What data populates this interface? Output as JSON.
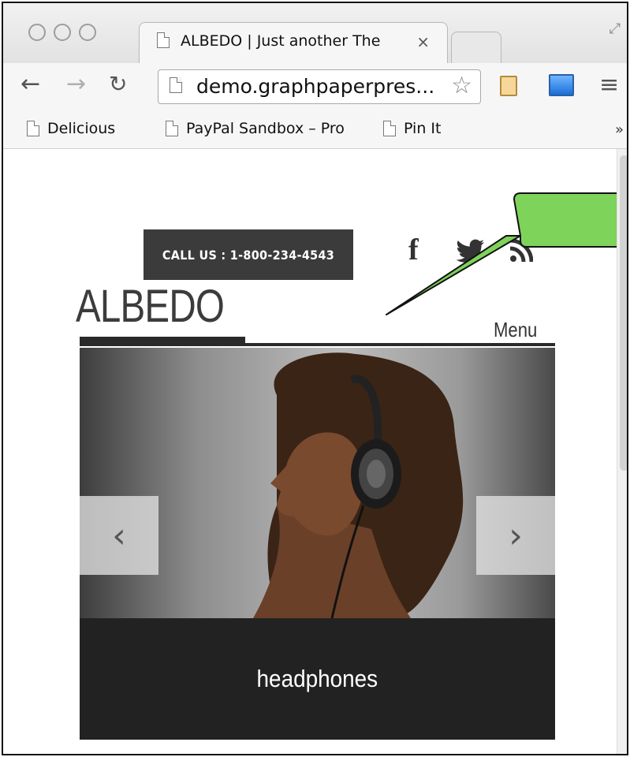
{
  "browser": {
    "tab": {
      "title": "ALBEDO | Just another The",
      "close": "×"
    },
    "address": {
      "url": "demo.graphpaperpres..."
    },
    "bookmarks": [
      {
        "label": "Delicious"
      },
      {
        "label": "PayPal Sandbox – Pro"
      },
      {
        "label": "Pin It"
      }
    ],
    "bookmarks_more": "»"
  },
  "site": {
    "call_us": "CALL US : 1-800-234-4543",
    "social": {
      "facebook": "f",
      "twitter": "❧",
      "rss": "◥"
    },
    "logo": "ALBEDO",
    "menu": "Menu",
    "slider": {
      "prev": "‹",
      "next": "›",
      "caption": "headphones"
    }
  },
  "colors": {
    "callout_fill": "#7ed35a",
    "dark_bar": "#222222",
    "call_us_bg": "#3b3b3b"
  }
}
